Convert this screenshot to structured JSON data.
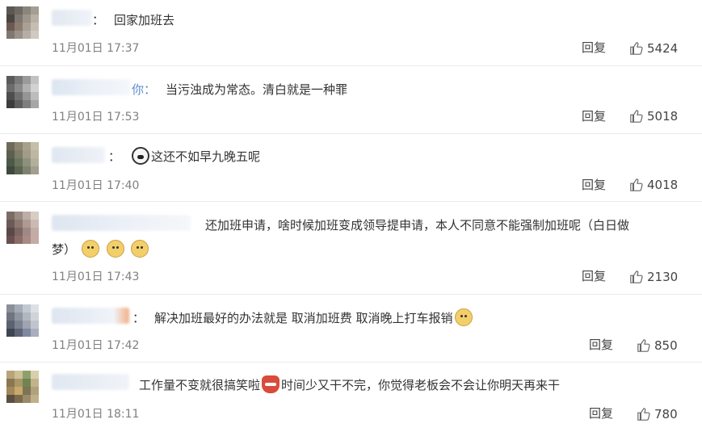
{
  "comments": [
    {
      "text": "回家加班去",
      "prefix": "",
      "colon": "：",
      "time": "11月01日 17:37",
      "reply": "回复",
      "likes": "5424"
    },
    {
      "text": "当污浊成为常态。清白就是一种罪",
      "prefix": "你：",
      "colon": "",
      "time": "11月01日 17:53",
      "reply": "回复",
      "likes": "5018"
    },
    {
      "text": "这还不如早九晚五呢",
      "prefix": "",
      "colon": "：",
      "time": "11月01日 17:40",
      "reply": "回复",
      "likes": "4018"
    },
    {
      "text_line1": "还加班申请，啥时候加班变成领导提申请，本人不同意不能强制加班呢（白日做",
      "text_line2": "梦）",
      "time": "11月01日 17:43",
      "reply": "回复",
      "likes": "2130"
    },
    {
      "text": "解决加班最好的办法就是 取消加班费 取消晚上打车报销",
      "colon": "：",
      "time": "11月01日 17:42",
      "reply": "回复",
      "likes": "850"
    },
    {
      "text_part1": "工作量不变就很搞笑啦",
      "text_part2": "时间少又干不完，你觉得老板会不会让你明天再来干",
      "time": "11月01日 18:11",
      "reply": "回复",
      "likes": "780"
    }
  ],
  "icons": {
    "like": "thumbs-up-icon",
    "emoji_doge": "doge-emoji-icon",
    "emoji_panda": "panda-emoji-icon",
    "emoji_angry": "angry-emoji-icon"
  }
}
